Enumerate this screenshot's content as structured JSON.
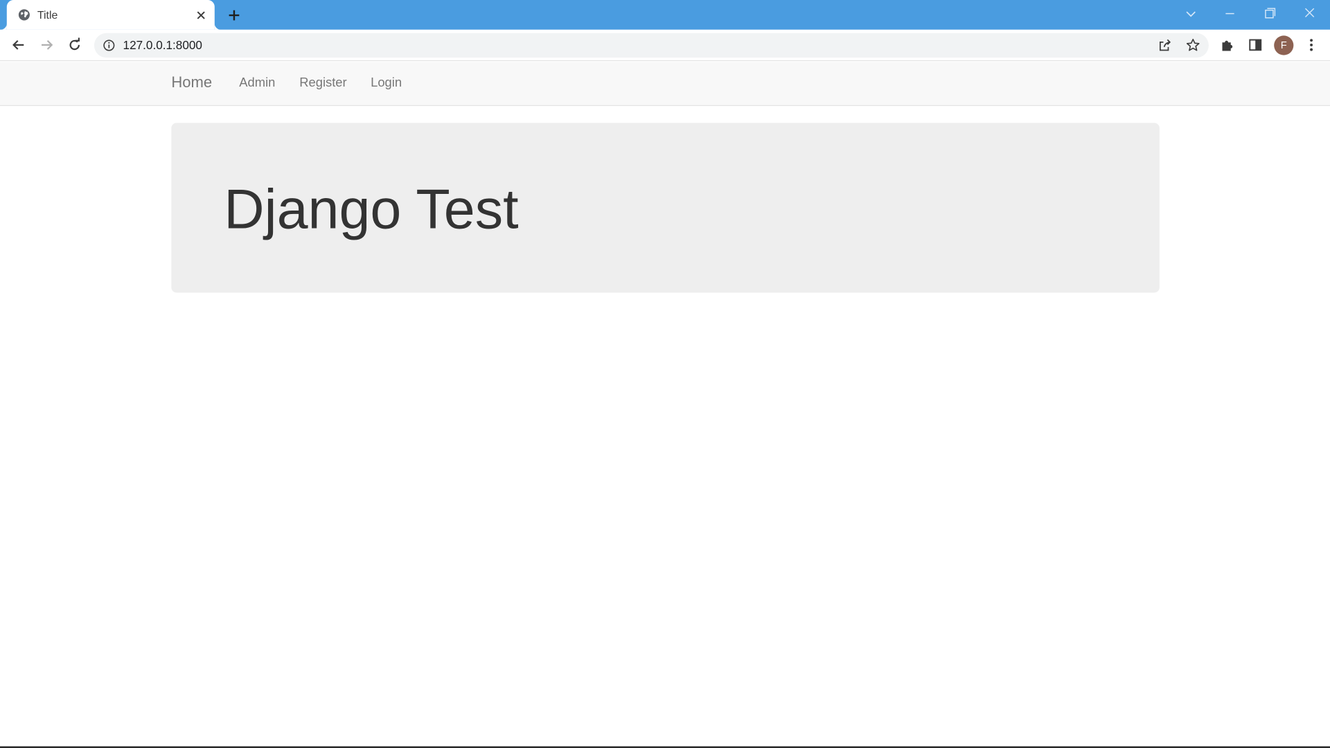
{
  "browser": {
    "tab_title": "Title",
    "url": "127.0.0.1:8000",
    "profile_initial": "F",
    "accent_color": "#4a9ce0"
  },
  "navbar": {
    "brand": "Home",
    "links": [
      "Admin",
      "Register",
      "Login"
    ]
  },
  "main": {
    "heading": "Django Test"
  }
}
